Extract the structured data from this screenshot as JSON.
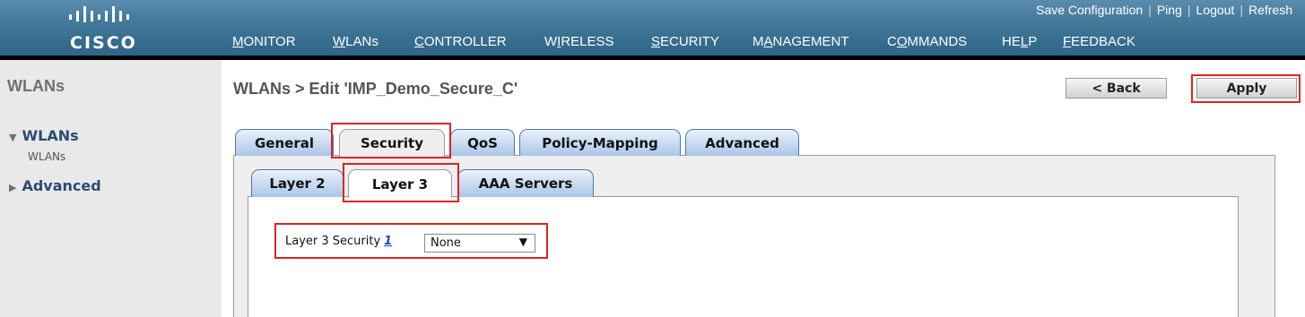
{
  "header": {
    "logo_text": "CISCO",
    "utility_links": [
      "Save Configuration",
      "Ping",
      "Logout",
      "Refresh"
    ],
    "nav": [
      {
        "label": "MONITOR",
        "u": "M"
      },
      {
        "label": "WLANs",
        "u": "W",
        "active": true
      },
      {
        "label": "CONTROLLER",
        "u": "C"
      },
      {
        "label": "WIRELESS",
        "u": "I"
      },
      {
        "label": "SECURITY",
        "u": "S"
      },
      {
        "label": "MANAGEMENT",
        "u": "A"
      },
      {
        "label": "COMMANDS",
        "u": "O"
      },
      {
        "label": "HELP",
        "u": "L"
      },
      {
        "label": "FEEDBACK",
        "u": "F"
      }
    ]
  },
  "sidebar": {
    "title": "WLANs",
    "items": [
      {
        "label": "WLANs",
        "expanded": true,
        "children": [
          "WLANs"
        ]
      },
      {
        "label": "Advanced",
        "expanded": false
      }
    ]
  },
  "page": {
    "title": "WLANs > Edit  'IMP_Demo_Secure_C'",
    "back_button": "< Back",
    "apply_button": "Apply"
  },
  "tabs": [
    "General",
    "Security",
    "QoS",
    "Policy-Mapping",
    "Advanced"
  ],
  "active_tab": "Security",
  "sub_tabs": [
    "Layer 2",
    "Layer 3",
    "AAA Servers"
  ],
  "active_sub_tab": "Layer 3",
  "form": {
    "layer3_security_label": "Layer 3 Security",
    "footnote_ref": "1",
    "layer3_security_value": "None"
  },
  "colors": {
    "header_blue": "#3f7597",
    "highlight_red": "#e12222",
    "tab_blue": "#a9c6e7"
  },
  "icons": {
    "sidebar_expanded": "triangle-down-icon",
    "sidebar_collapsed": "triangle-right-icon",
    "select_arrow": "chevron-down-icon"
  }
}
